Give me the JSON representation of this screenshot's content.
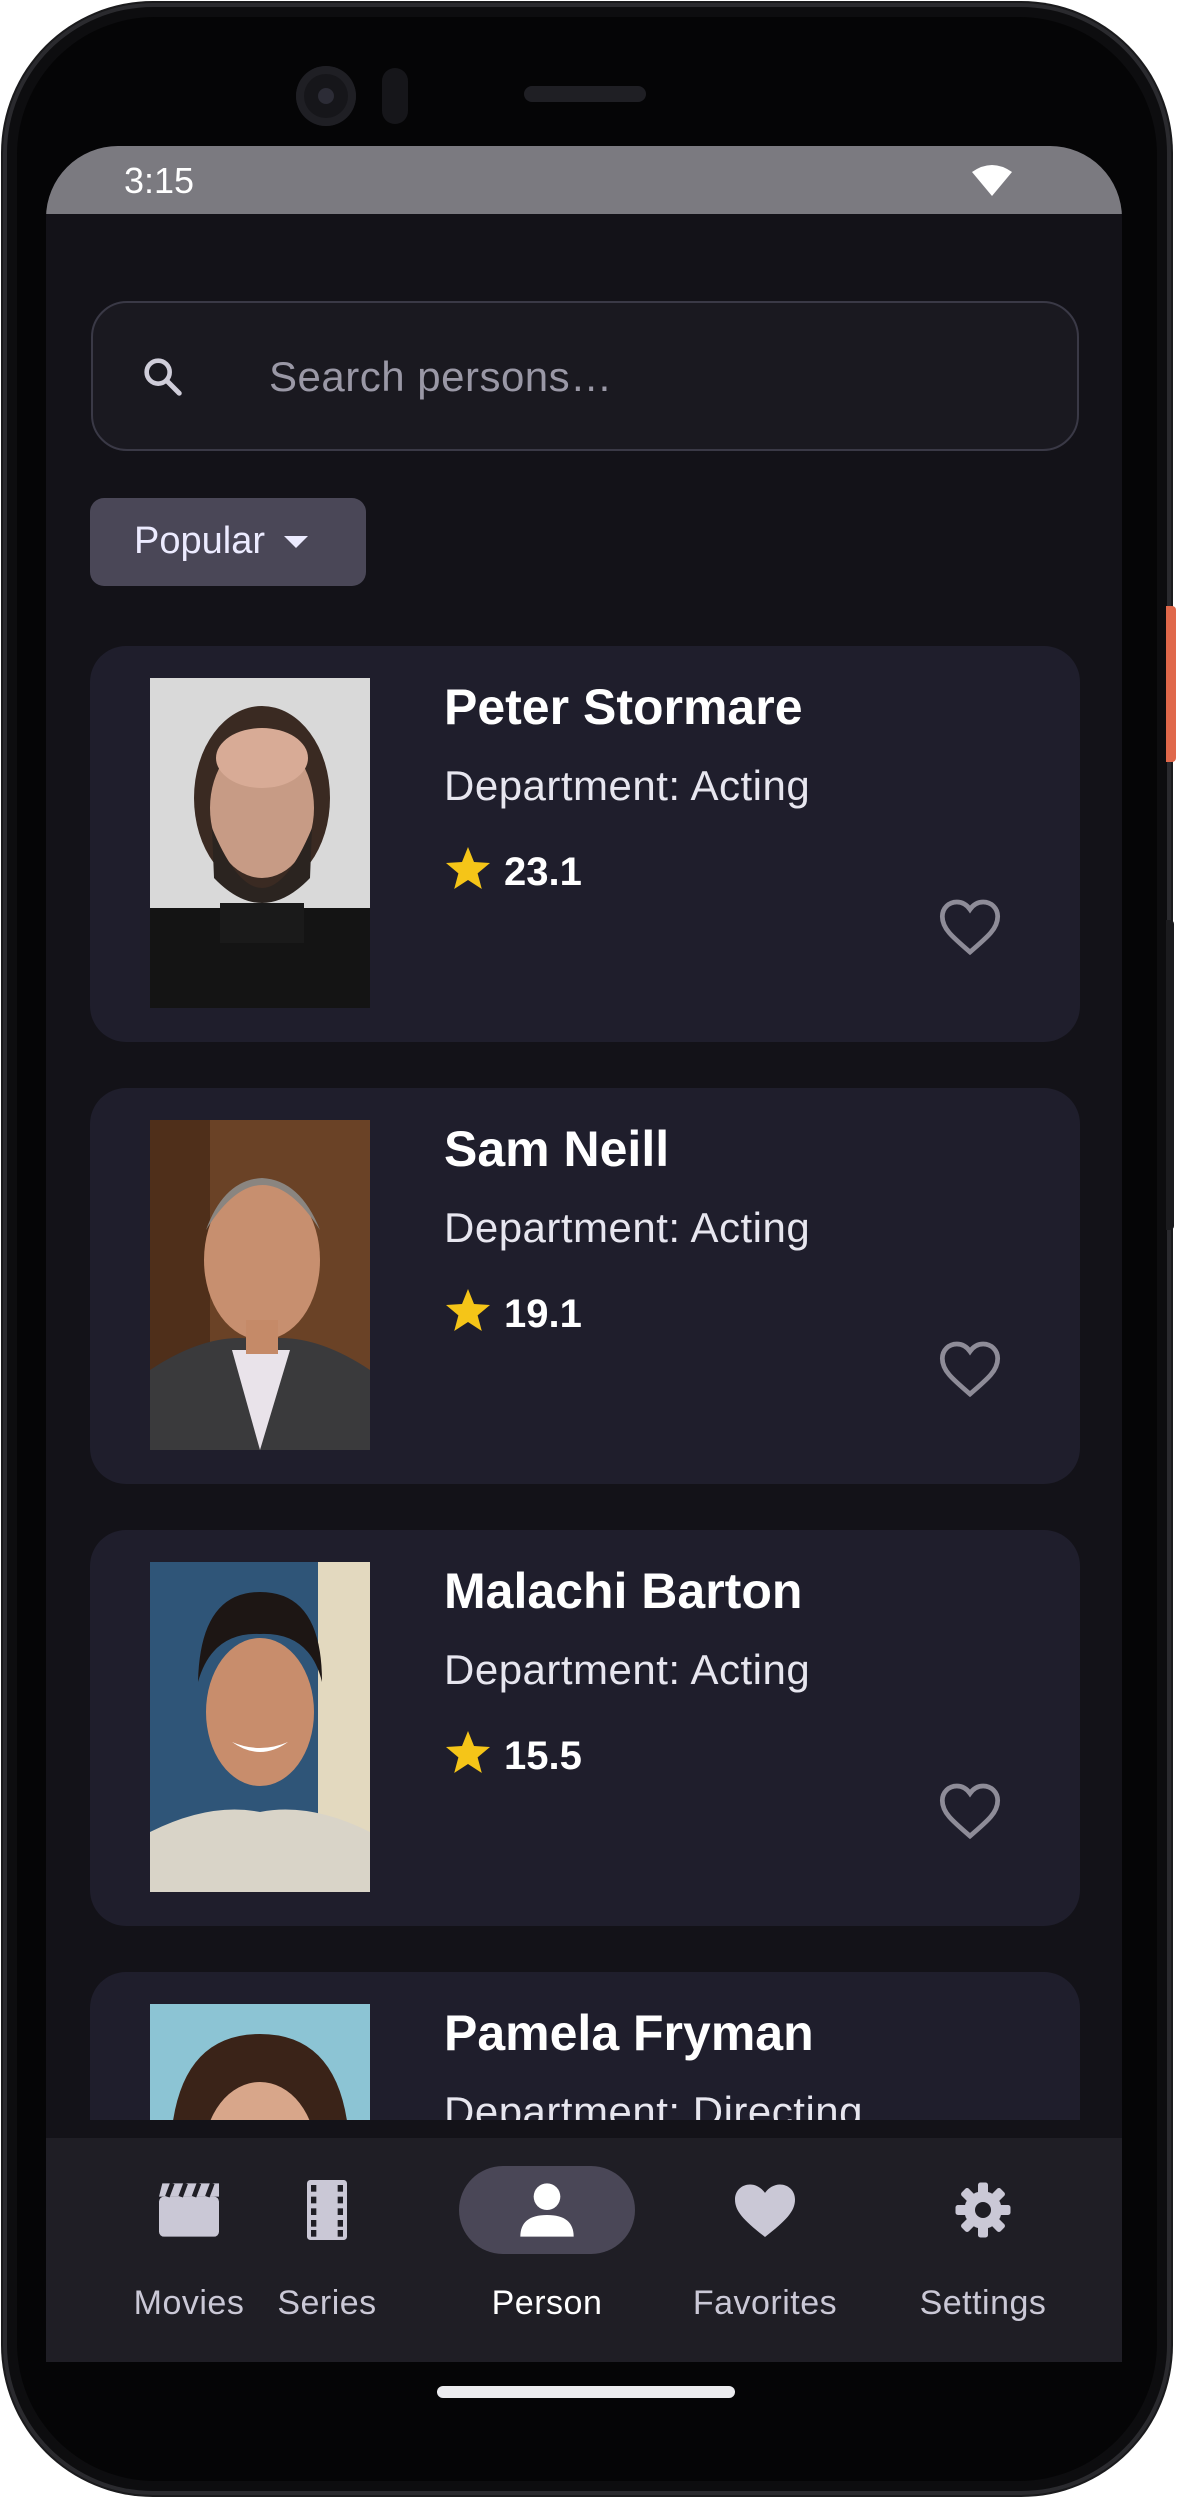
{
  "status_bar": {
    "time": "3:15",
    "wifi_icon": "wifi-icon"
  },
  "search": {
    "placeholder": "Search persons…",
    "icon": "search-icon"
  },
  "filter": {
    "label": "Popular",
    "icon": "caret-down-icon"
  },
  "persons": [
    {
      "name": "Peter Stormare",
      "department": "Department: Acting",
      "popularity": "23.1",
      "favorite": false
    },
    {
      "name": "Sam Neill",
      "department": "Department: Acting",
      "popularity": "19.1",
      "favorite": false
    },
    {
      "name": "Malachi Barton",
      "department": "Department: Acting",
      "popularity": "15.5",
      "favorite": false
    },
    {
      "name": "Pamela Fryman",
      "department": "Department: Directing",
      "popularity": "",
      "favorite": false
    }
  ],
  "bottom_nav": [
    {
      "label": "Movies",
      "icon": "movie-icon",
      "active": false
    },
    {
      "label": "Series",
      "icon": "film-strip-icon",
      "active": false
    },
    {
      "label": "Person",
      "icon": "person-icon",
      "active": true
    },
    {
      "label": "Favorites",
      "icon": "heart-icon",
      "active": false
    },
    {
      "label": "Settings",
      "icon": "gear-icon",
      "active": false
    }
  ],
  "colors": {
    "background": "#131218",
    "card": "#1f1e2c",
    "accent_pill": "#4a4757",
    "star": "#f5c518",
    "heart_outline": "#8e8c98"
  }
}
